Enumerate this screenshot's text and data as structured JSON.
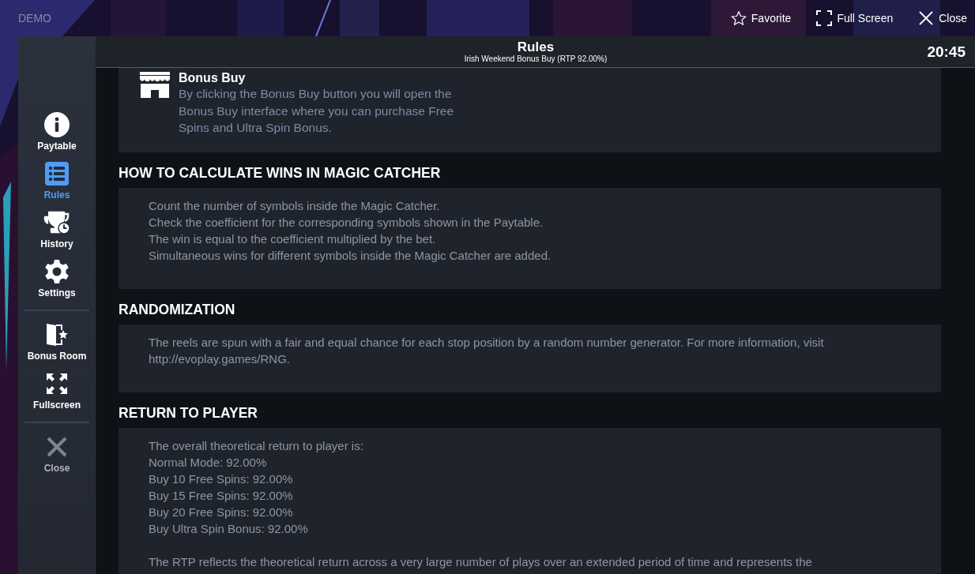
{
  "top_bar": {
    "label": "DEMO",
    "actions": [
      {
        "label": "Favorite",
        "kind": "favorite"
      },
      {
        "label": "Full Screen",
        "kind": "fullscreen"
      },
      {
        "label": "Close",
        "kind": "close"
      }
    ]
  },
  "sidebar": {
    "groups": [
      [
        {
          "label": "Paytable",
          "kind": "paytable",
          "selected": false,
          "disabled": false
        },
        {
          "label": "Rules",
          "kind": "rules",
          "selected": true,
          "disabled": false
        },
        {
          "label": "History",
          "kind": "history",
          "selected": false,
          "disabled": false
        },
        {
          "label": "Settings",
          "kind": "settings",
          "selected": false,
          "disabled": false
        }
      ],
      [
        {
          "label": "Bonus Room",
          "kind": "bonus",
          "selected": false,
          "disabled": false
        },
        {
          "label": "Fullscreen",
          "kind": "fullscreen",
          "selected": false,
          "disabled": false
        }
      ],
      [
        {
          "label": "Close",
          "kind": "close",
          "selected": false,
          "disabled": true
        }
      ]
    ]
  },
  "header": {
    "title": "Rules",
    "subtitle": "Irish Weekend Bonus Buy (RTP 92.00%)",
    "time": "20:45"
  },
  "sections": [
    {
      "kind": "feature",
      "title": "Bonus Buy",
      "paragraphs": [
        [
          "By clicking the Bonus Buy button you will open the Bonus Buy interface where you can purchase Free Spins and Ultra Spin Bonus."
        ]
      ]
    },
    {
      "kind": "section",
      "title": "HOW TO CALCULATE WINS IN MAGIC CATCHER",
      "paragraphs": [
        [
          "Count the number of symbols inside the Magic Catcher.",
          "Check the coefficient for the corresponding symbols shown in the Paytable.",
          "The win is equal to the coefficient multiplied by the bet.",
          "Simultaneous wins for different symbols inside the Magic Catcher are added."
        ]
      ]
    },
    {
      "kind": "section",
      "title": "RANDOMIZATION",
      "paragraphs": [
        [
          "The reels are spun with a fair and equal chance for each stop position by a random number generator. For more information, visit http://evoplay.games/RNG."
        ]
      ]
    },
    {
      "kind": "section",
      "title": "RETURN TO PLAYER",
      "paragraphs": [
        [
          "The overall theoretical return to player is:",
          "Normal Mode: 92.00%",
          "Buy 10 Free Spins: 92.00%",
          "Buy 15 Free Spins: 92.00%",
          "Buy 20 Free Spins: 92.00%",
          "Buy Ultra Spin Bonus: 92.00%"
        ],
        [
          "The RTP reflects the theoretical return across a very large number of plays over an extended period of time and represents the"
        ]
      ]
    }
  ]
}
